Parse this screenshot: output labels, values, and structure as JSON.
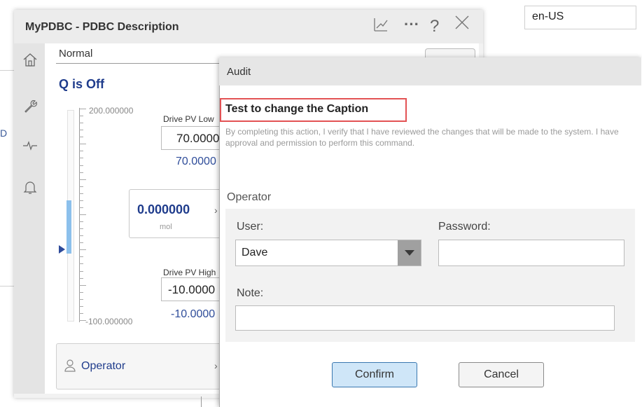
{
  "background": {
    "fragment": "D",
    "language": "en-US"
  },
  "faceplate": {
    "title": "MyPDBC - PDBC Description",
    "icons": {
      "trend": "trend-icon",
      "more": "more-icon",
      "help": "help-icon",
      "close": "close-icon"
    },
    "sidebar": [
      "home-icon",
      "wrench-icon",
      "pulse-icon",
      "bell-icon"
    ],
    "mode": "Normal",
    "state": "Q is Off",
    "bar": {
      "max_label": "200.000000",
      "min_label": "-100.000000",
      "level_fraction": 0.35
    },
    "drive_pv_low": {
      "label": "Drive PV Low",
      "input_value": "70.0000",
      "current_value": "70.0000"
    },
    "pv": {
      "value": "0.000000",
      "unit": "mol"
    },
    "drive_pv_high": {
      "label": "Drive PV High",
      "input_value": "-10.0000",
      "current_value": "-10.0000"
    },
    "operator_tab": {
      "label": "Operator"
    }
  },
  "audit": {
    "title": "Audit",
    "caption": "Test to change the Caption",
    "verify_text": "By completing this action, I verify that I have reviewed the changes that will be made to the system. I have approval and permission to perform this command.",
    "operator_heading": "Operator",
    "user_label": "User:",
    "user_value": "Dave",
    "password_label": "Password:",
    "note_label": "Note:",
    "confirm_label": "Confirm",
    "cancel_label": "Cancel"
  },
  "colors": {
    "accent_blue": "#1f3c8c",
    "highlight_red": "#e35254",
    "confirm_fill": "#cfe6f8"
  }
}
